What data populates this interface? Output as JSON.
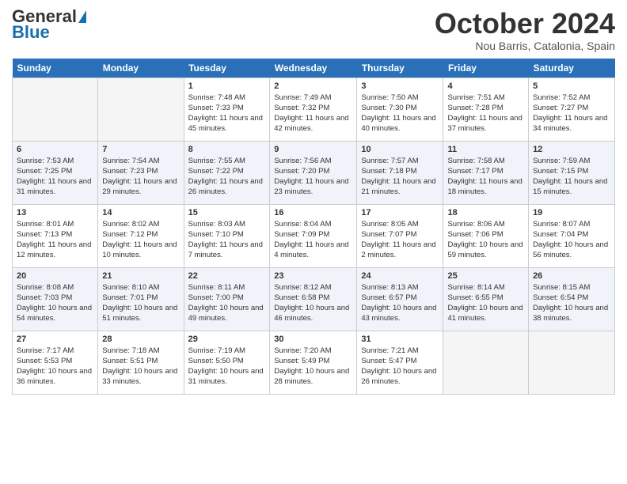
{
  "header": {
    "logo_general": "General",
    "logo_blue": "Blue",
    "title": "October 2024",
    "location": "Nou Barris, Catalonia, Spain"
  },
  "days_of_week": [
    "Sunday",
    "Monday",
    "Tuesday",
    "Wednesday",
    "Thursday",
    "Friday",
    "Saturday"
  ],
  "weeks": [
    [
      {
        "day": "",
        "empty": true
      },
      {
        "day": "",
        "empty": true
      },
      {
        "day": "1",
        "sunrise": "Sunrise: 7:48 AM",
        "sunset": "Sunset: 7:33 PM",
        "daylight": "Daylight: 11 hours and 45 minutes."
      },
      {
        "day": "2",
        "sunrise": "Sunrise: 7:49 AM",
        "sunset": "Sunset: 7:32 PM",
        "daylight": "Daylight: 11 hours and 42 minutes."
      },
      {
        "day": "3",
        "sunrise": "Sunrise: 7:50 AM",
        "sunset": "Sunset: 7:30 PM",
        "daylight": "Daylight: 11 hours and 40 minutes."
      },
      {
        "day": "4",
        "sunrise": "Sunrise: 7:51 AM",
        "sunset": "Sunset: 7:28 PM",
        "daylight": "Daylight: 11 hours and 37 minutes."
      },
      {
        "day": "5",
        "sunrise": "Sunrise: 7:52 AM",
        "sunset": "Sunset: 7:27 PM",
        "daylight": "Daylight: 11 hours and 34 minutes."
      }
    ],
    [
      {
        "day": "6",
        "sunrise": "Sunrise: 7:53 AM",
        "sunset": "Sunset: 7:25 PM",
        "daylight": "Daylight: 11 hours and 31 minutes."
      },
      {
        "day": "7",
        "sunrise": "Sunrise: 7:54 AM",
        "sunset": "Sunset: 7:23 PM",
        "daylight": "Daylight: 11 hours and 29 minutes."
      },
      {
        "day": "8",
        "sunrise": "Sunrise: 7:55 AM",
        "sunset": "Sunset: 7:22 PM",
        "daylight": "Daylight: 11 hours and 26 minutes."
      },
      {
        "day": "9",
        "sunrise": "Sunrise: 7:56 AM",
        "sunset": "Sunset: 7:20 PM",
        "daylight": "Daylight: 11 hours and 23 minutes."
      },
      {
        "day": "10",
        "sunrise": "Sunrise: 7:57 AM",
        "sunset": "Sunset: 7:18 PM",
        "daylight": "Daylight: 11 hours and 21 minutes."
      },
      {
        "day": "11",
        "sunrise": "Sunrise: 7:58 AM",
        "sunset": "Sunset: 7:17 PM",
        "daylight": "Daylight: 11 hours and 18 minutes."
      },
      {
        "day": "12",
        "sunrise": "Sunrise: 7:59 AM",
        "sunset": "Sunset: 7:15 PM",
        "daylight": "Daylight: 11 hours and 15 minutes."
      }
    ],
    [
      {
        "day": "13",
        "sunrise": "Sunrise: 8:01 AM",
        "sunset": "Sunset: 7:13 PM",
        "daylight": "Daylight: 11 hours and 12 minutes."
      },
      {
        "day": "14",
        "sunrise": "Sunrise: 8:02 AM",
        "sunset": "Sunset: 7:12 PM",
        "daylight": "Daylight: 11 hours and 10 minutes."
      },
      {
        "day": "15",
        "sunrise": "Sunrise: 8:03 AM",
        "sunset": "Sunset: 7:10 PM",
        "daylight": "Daylight: 11 hours and 7 minutes."
      },
      {
        "day": "16",
        "sunrise": "Sunrise: 8:04 AM",
        "sunset": "Sunset: 7:09 PM",
        "daylight": "Daylight: 11 hours and 4 minutes."
      },
      {
        "day": "17",
        "sunrise": "Sunrise: 8:05 AM",
        "sunset": "Sunset: 7:07 PM",
        "daylight": "Daylight: 11 hours and 2 minutes."
      },
      {
        "day": "18",
        "sunrise": "Sunrise: 8:06 AM",
        "sunset": "Sunset: 7:06 PM",
        "daylight": "Daylight: 10 hours and 59 minutes."
      },
      {
        "day": "19",
        "sunrise": "Sunrise: 8:07 AM",
        "sunset": "Sunset: 7:04 PM",
        "daylight": "Daylight: 10 hours and 56 minutes."
      }
    ],
    [
      {
        "day": "20",
        "sunrise": "Sunrise: 8:08 AM",
        "sunset": "Sunset: 7:03 PM",
        "daylight": "Daylight: 10 hours and 54 minutes."
      },
      {
        "day": "21",
        "sunrise": "Sunrise: 8:10 AM",
        "sunset": "Sunset: 7:01 PM",
        "daylight": "Daylight: 10 hours and 51 minutes."
      },
      {
        "day": "22",
        "sunrise": "Sunrise: 8:11 AM",
        "sunset": "Sunset: 7:00 PM",
        "daylight": "Daylight: 10 hours and 49 minutes."
      },
      {
        "day": "23",
        "sunrise": "Sunrise: 8:12 AM",
        "sunset": "Sunset: 6:58 PM",
        "daylight": "Daylight: 10 hours and 46 minutes."
      },
      {
        "day": "24",
        "sunrise": "Sunrise: 8:13 AM",
        "sunset": "Sunset: 6:57 PM",
        "daylight": "Daylight: 10 hours and 43 minutes."
      },
      {
        "day": "25",
        "sunrise": "Sunrise: 8:14 AM",
        "sunset": "Sunset: 6:55 PM",
        "daylight": "Daylight: 10 hours and 41 minutes."
      },
      {
        "day": "26",
        "sunrise": "Sunrise: 8:15 AM",
        "sunset": "Sunset: 6:54 PM",
        "daylight": "Daylight: 10 hours and 38 minutes."
      }
    ],
    [
      {
        "day": "27",
        "sunrise": "Sunrise: 7:17 AM",
        "sunset": "Sunset: 5:53 PM",
        "daylight": "Daylight: 10 hours and 36 minutes."
      },
      {
        "day": "28",
        "sunrise": "Sunrise: 7:18 AM",
        "sunset": "Sunset: 5:51 PM",
        "daylight": "Daylight: 10 hours and 33 minutes."
      },
      {
        "day": "29",
        "sunrise": "Sunrise: 7:19 AM",
        "sunset": "Sunset: 5:50 PM",
        "daylight": "Daylight: 10 hours and 31 minutes."
      },
      {
        "day": "30",
        "sunrise": "Sunrise: 7:20 AM",
        "sunset": "Sunset: 5:49 PM",
        "daylight": "Daylight: 10 hours and 28 minutes."
      },
      {
        "day": "31",
        "sunrise": "Sunrise: 7:21 AM",
        "sunset": "Sunset: 5:47 PM",
        "daylight": "Daylight: 10 hours and 26 minutes."
      },
      {
        "day": "",
        "empty": true
      },
      {
        "day": "",
        "empty": true
      }
    ]
  ]
}
